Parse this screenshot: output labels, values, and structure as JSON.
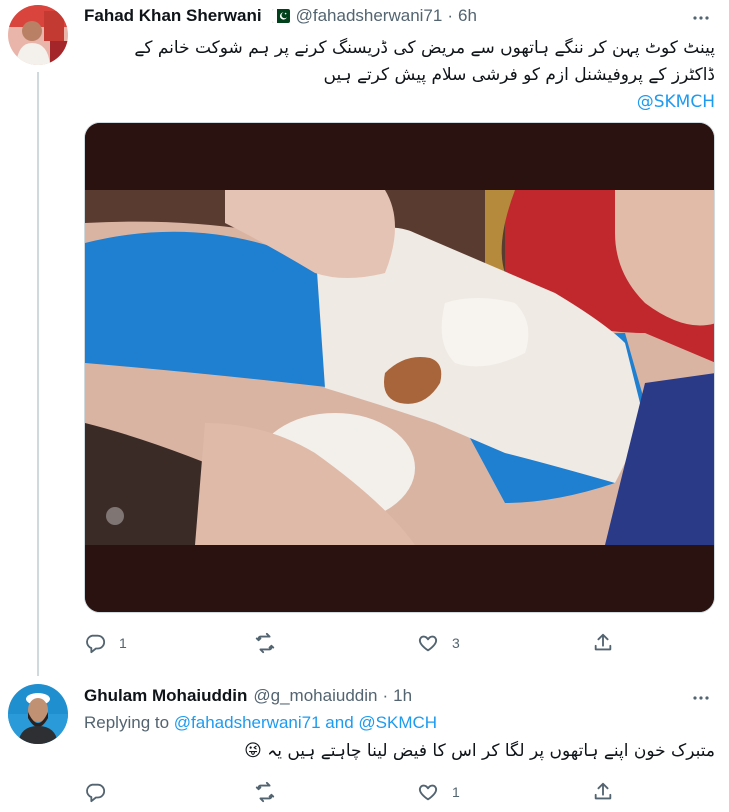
{
  "tweet1": {
    "name": "Fahad Khan Sherwani",
    "handle": "@fahadsherwani71",
    "separator": "·",
    "time": "6h",
    "text_line1": "پینٹ کوٹ پہن کر ننگے ہاتھوں سے مریض کی ڈریسنگ کرنے پر ہم شوکت خانم کے",
    "text_line2": "ڈاکٹرز کے پروفیشنل ازم کو فرشی سلام پیش کرتے ہیں",
    "mention": "@SKMCH",
    "actions": {
      "reply_count": "1",
      "retweet_count": "",
      "like_count": "3"
    }
  },
  "tweet2": {
    "name": "Ghulam Mohaiuddin",
    "handle": "@g_mohaiuddin",
    "separator": "·",
    "time": "1h",
    "replying_prefix": "Replying to",
    "replying_user1": "@fahadsherwani71",
    "replying_and": "and",
    "replying_user2": "@SKMCH",
    "text": "متبرک خون اپنے ہاتھوں پر لگا کر اس کا فیض لینا چاہتے ہیں یہ",
    "emoji": "😜",
    "actions": {
      "reply_count": "",
      "retweet_count": "",
      "like_count": "1"
    }
  },
  "icons": {
    "reply": "reply-icon",
    "retweet": "retweet-icon",
    "like": "heart-icon",
    "share": "share-icon",
    "more": "more-icon",
    "flag": "pakistan-flag-icon"
  },
  "colors": {
    "accent": "#1d9bf0",
    "secondary_text": "#536471",
    "divider": "#cfd9de"
  }
}
